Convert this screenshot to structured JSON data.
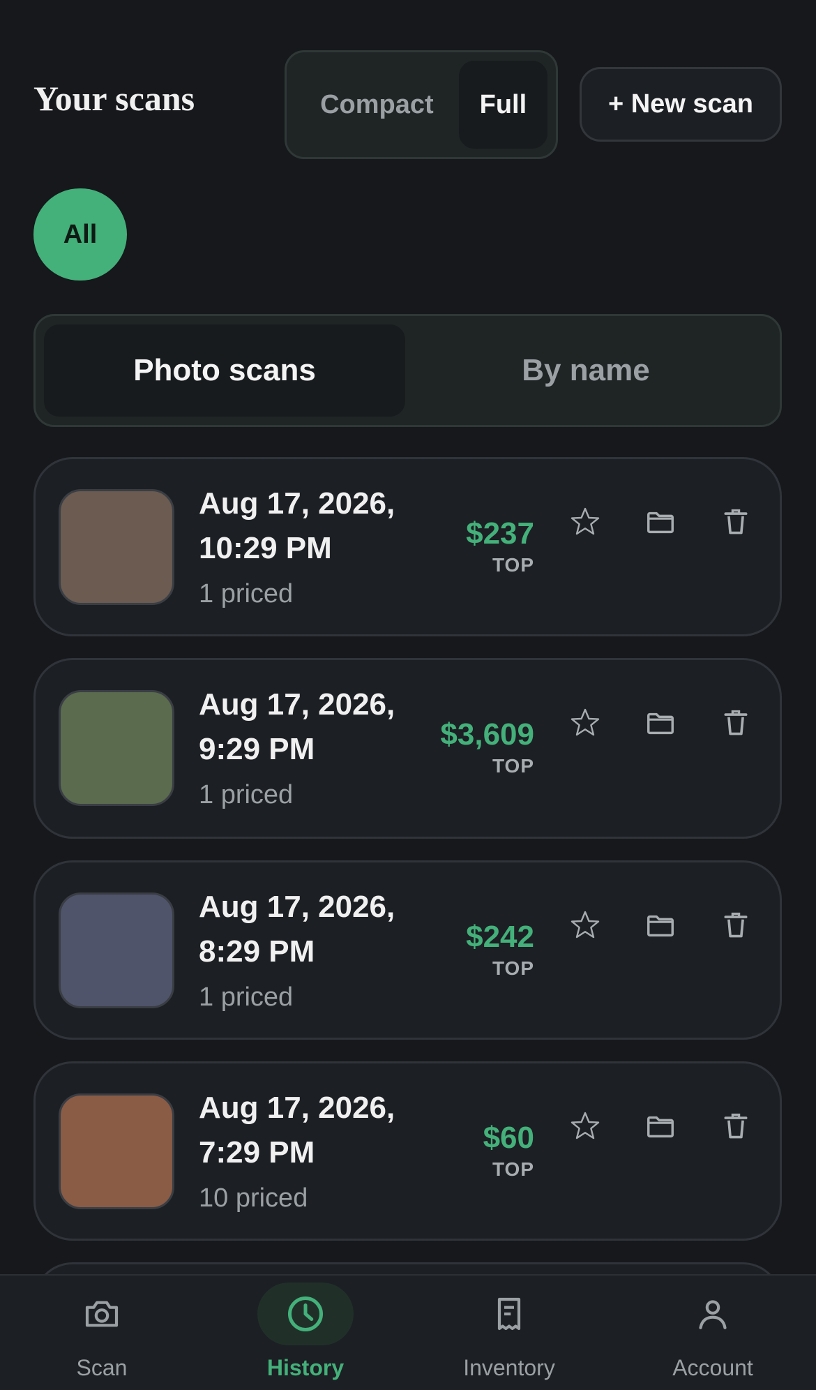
{
  "header": {
    "title": "Your scans",
    "view_modes": [
      "Compact",
      "Full"
    ],
    "view_selected": "Full",
    "new_scan_label": "+ New scan"
  },
  "filters": {
    "all_label": "All"
  },
  "sort": {
    "options": [
      "Photo scans",
      "By name"
    ],
    "selected": "Photo scans"
  },
  "scans": [
    {
      "date_line1": "Aug 17, 2026,",
      "date_line2": "10:29 PM",
      "priced": "1 priced",
      "price": "$237",
      "price_tag": "TOP",
      "thumb_color": "#6b5b50"
    },
    {
      "date_line1": "Aug 17, 2026,",
      "date_line2": "9:29 PM",
      "priced": "1 priced",
      "price": "$3,609",
      "price_tag": "TOP",
      "thumb_color": "#5a6b4e"
    },
    {
      "date_line1": "Aug 17, 2026,",
      "date_line2": "8:29 PM",
      "priced": "1 priced",
      "price": "$242",
      "price_tag": "TOP",
      "thumb_color": "#4f546b"
    },
    {
      "date_line1": "Aug 17, 2026,",
      "date_line2": "7:29 PM",
      "priced": "10 priced",
      "price": "$60",
      "price_tag": "TOP",
      "thumb_color": "#8a5b45"
    }
  ],
  "card_actions": {
    "favorite_icon": "star-icon",
    "folder_icon": "folder-icon",
    "delete_icon": "trash-icon"
  },
  "nav": {
    "items": [
      {
        "label": "Scan",
        "icon": "camera-icon"
      },
      {
        "label": "History",
        "icon": "clock-icon"
      },
      {
        "label": "Inventory",
        "icon": "receipt-icon"
      },
      {
        "label": "Account",
        "icon": "person-icon"
      }
    ],
    "active": "History"
  },
  "colors": {
    "accent": "#44b07a",
    "background": "#16181b",
    "card": "#1c1f23",
    "muted_text": "#9aa0a4"
  }
}
